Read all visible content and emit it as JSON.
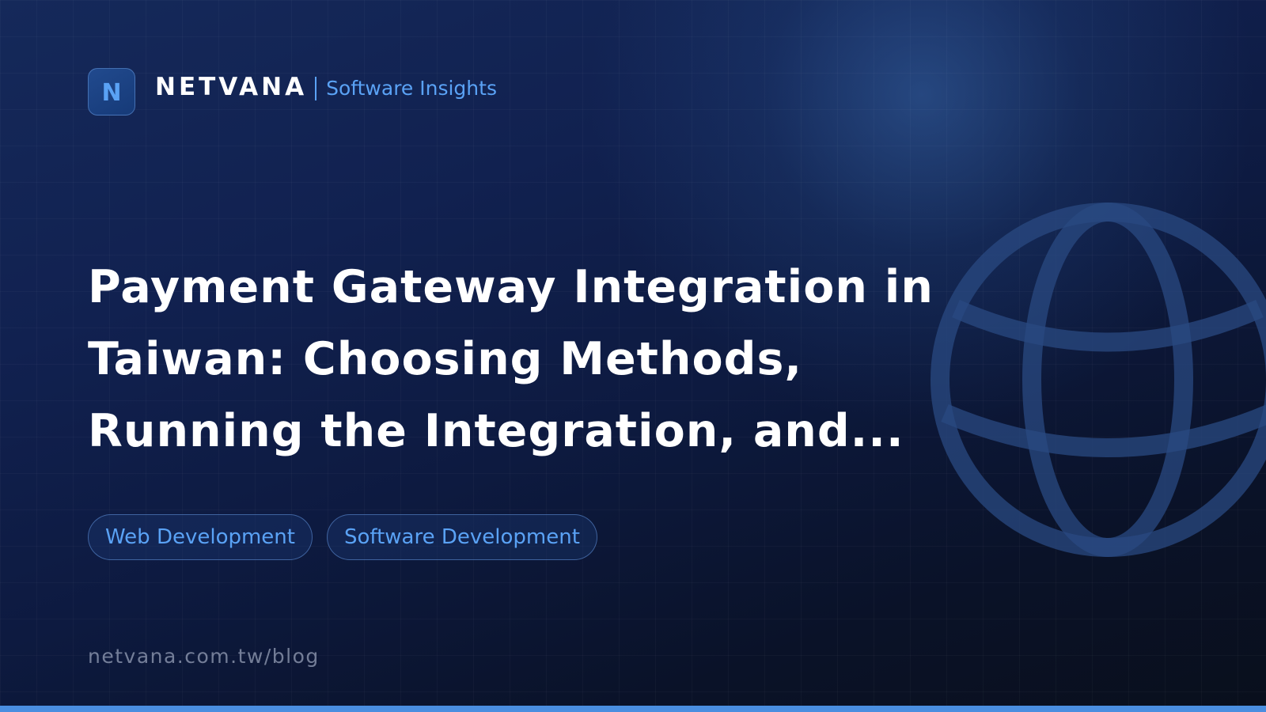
{
  "brand": {
    "logo_letter": "N",
    "name": "NETVANA",
    "tagline": "Software Insights"
  },
  "title": {
    "lines": [
      "Payment Gateway Integration in",
      "Taiwan: Choosing Methods,",
      "Running the Integration, and..."
    ]
  },
  "tags": [
    {
      "label": "Web Development"
    },
    {
      "label": "Software Development"
    }
  ],
  "footer": {
    "url": "netvana.com.tw/blog"
  },
  "decoration": {
    "background_icon": "globe-icon"
  },
  "colors": {
    "accent": "#5aa2f5",
    "bottom_bar": "#4a8ee0",
    "background_dark": "#0d1a40"
  }
}
